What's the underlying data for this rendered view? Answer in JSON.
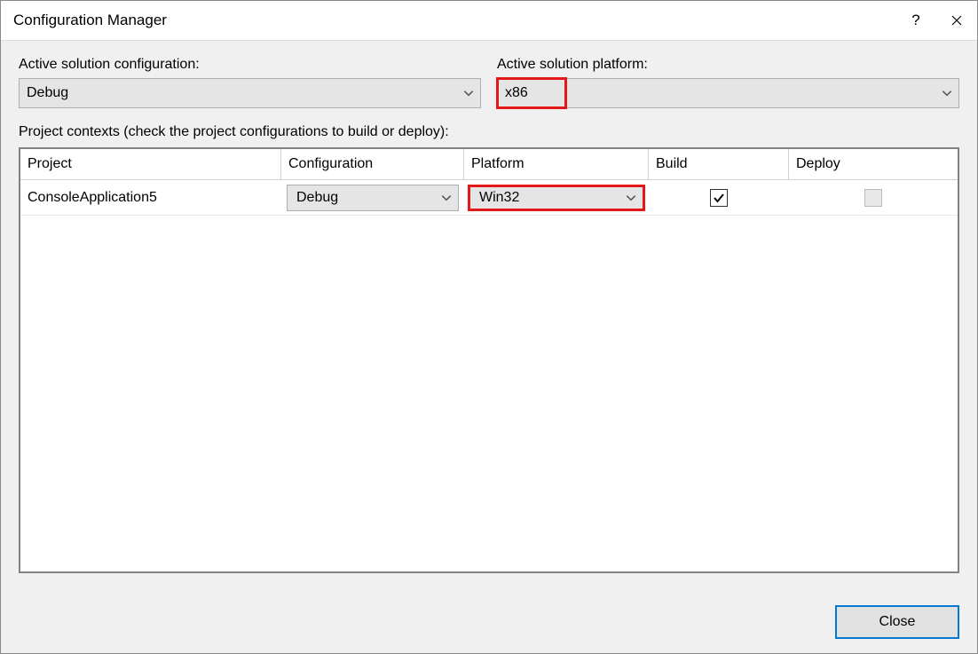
{
  "window": {
    "title": "Configuration Manager"
  },
  "labels": {
    "active_config": "Active solution configuration:",
    "active_platform": "Active solution platform:",
    "contexts": "Project contexts (check the project configurations to build or deploy):"
  },
  "dropdowns": {
    "active_config_value": "Debug",
    "active_platform_value": "x86"
  },
  "grid": {
    "headers": {
      "project": "Project",
      "configuration": "Configuration",
      "platform": "Platform",
      "build": "Build",
      "deploy": "Deploy"
    },
    "rows": [
      {
        "project": "ConsoleApplication5",
        "configuration": "Debug",
        "platform": "Win32",
        "build": true,
        "deploy_enabled": false
      }
    ]
  },
  "footer": {
    "close_label": "Close"
  }
}
